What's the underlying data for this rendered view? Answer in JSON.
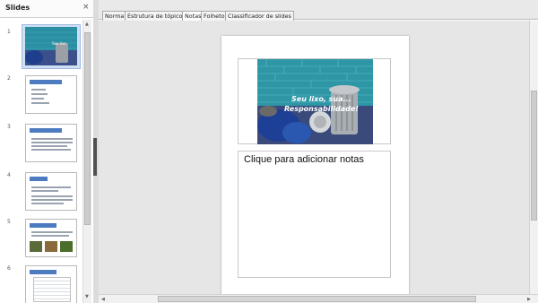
{
  "slides_pane": {
    "title": "Slides",
    "close_glyph": "×",
    "thumbnails": [
      {
        "number": "1",
        "selected": true
      },
      {
        "number": "2",
        "selected": false
      },
      {
        "number": "3",
        "selected": false
      },
      {
        "number": "4",
        "selected": false
      },
      {
        "number": "5",
        "selected": false
      },
      {
        "number": "6",
        "selected": false
      }
    ]
  },
  "tabs": [
    {
      "label": "Normal"
    },
    {
      "label": "Estrutura de tópicos"
    },
    {
      "label": "Notas",
      "active": true
    },
    {
      "label": "Folheto"
    },
    {
      "label": "Classificador de slides"
    }
  ],
  "page": {
    "slide_title_line1": "Seu lixo, sua...",
    "slide_title_line2": "Responsabilidade!",
    "notes_placeholder": "Clique para adicionar notas"
  },
  "icons": {
    "close": "close-icon",
    "scroll_up": "arrow-up-icon",
    "scroll_down": "arrow-down-icon"
  },
  "colors": {
    "accent": "#4d7bc0",
    "workspace_bg": "#e6e6e6"
  }
}
